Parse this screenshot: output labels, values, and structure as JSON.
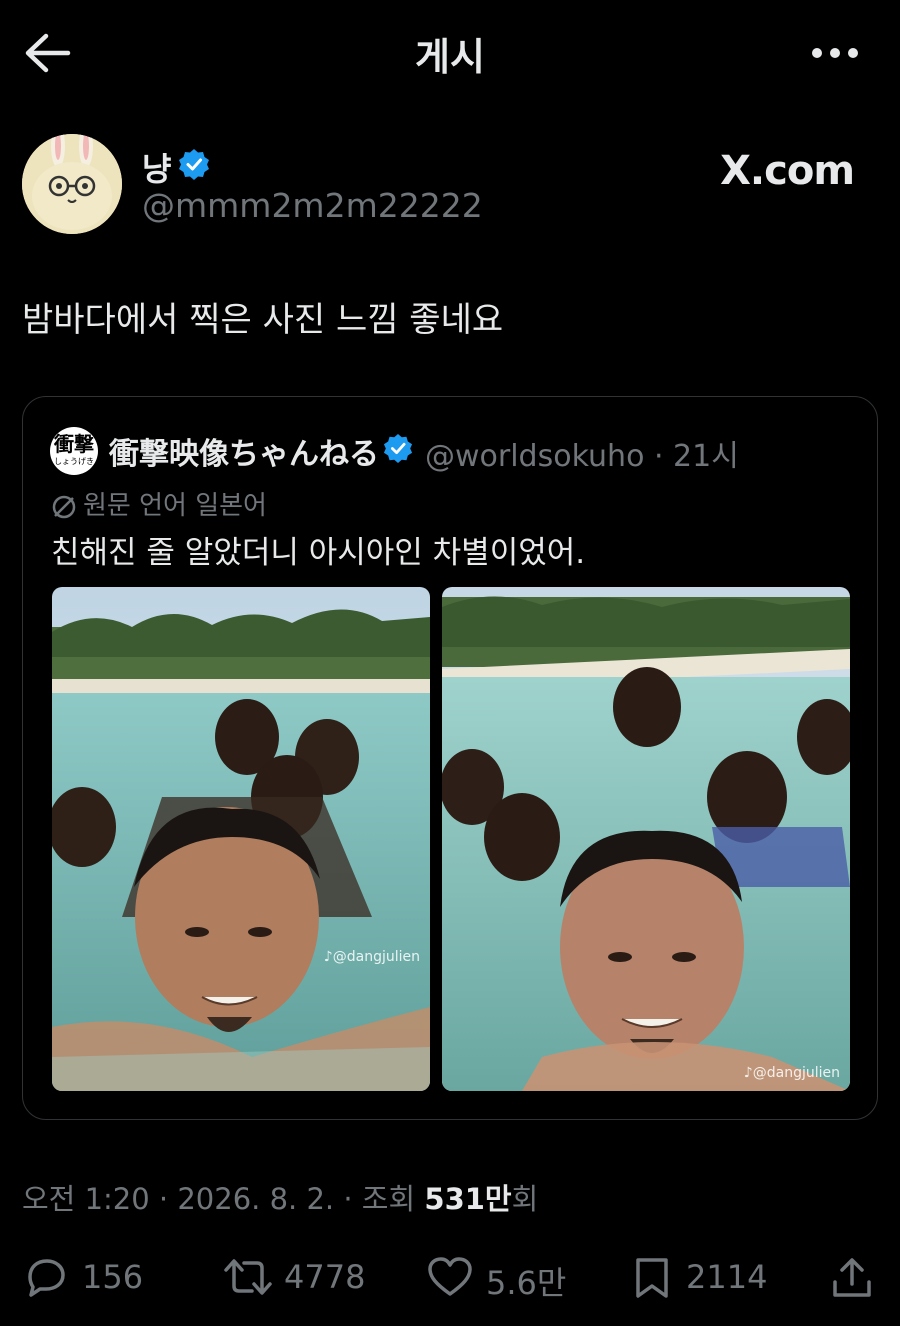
{
  "header": {
    "title": "게시",
    "back_icon": "arrow-left-icon",
    "more_icon": "ellipsis-icon"
  },
  "author": {
    "name": "냥",
    "handle": "@mmm2m2m22222",
    "verified": true,
    "source_logo": "X.com"
  },
  "post": {
    "text": "밤바다에서 찍은 사진 느낌 좋네요"
  },
  "quote": {
    "avatar_text": "衝撃",
    "avatar_subtext": "しょうげき",
    "name": "衝撃映像ちゃんねる",
    "handle_time": "@worldsokuho · 21시",
    "translate_label": "원문 언어 일본어",
    "text": "친해진 줄 알았더니 아시아인 차별이었어.",
    "photos": [
      {
        "watermark": "♪@dangjulien"
      },
      {
        "watermark": "♪@dangjulien"
      }
    ]
  },
  "meta": {
    "time_date": "오전 1:20 · 2026. 8. 2. · 조회 ",
    "views": "531만",
    "views_suffix": "회"
  },
  "actions": {
    "replies": "156",
    "reposts": "4778",
    "likes": "5.6만",
    "bookmarks": "2114"
  },
  "colors": {
    "background": "#000000",
    "text": "#e7e9ea",
    "muted": "#71767b",
    "verified": "#1d9bf0",
    "border": "#2f3336"
  }
}
